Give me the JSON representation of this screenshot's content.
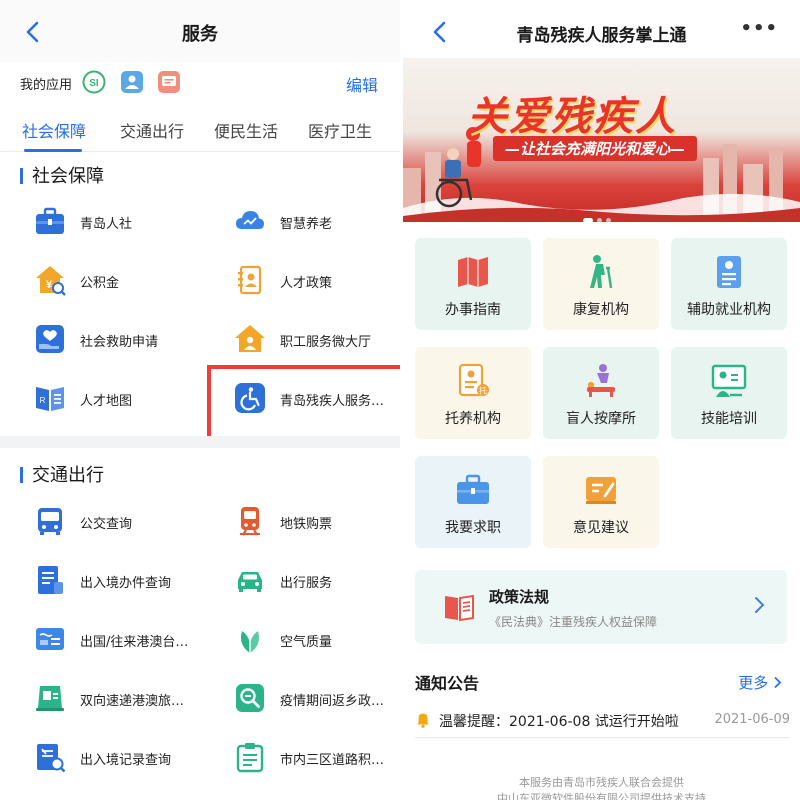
{
  "left": {
    "title": "服务",
    "my_apps_label": "我的应用",
    "my_apps_icons": [
      "si-icon",
      "person-card-icon",
      "chat-icon"
    ],
    "edit_label": "编辑",
    "tabs": [
      {
        "label": "社会保障",
        "active": true
      },
      {
        "label": "交通出行",
        "active": false
      },
      {
        "label": "便民生活",
        "active": false
      },
      {
        "label": "医疗卫生",
        "active": false
      }
    ],
    "sections": [
      {
        "title": "社会保障",
        "items": [
          {
            "label": "青岛人社",
            "icon": "briefcase-icon"
          },
          {
            "label": "智慧养老",
            "icon": "cloud-icon"
          },
          {
            "label": "公积金",
            "icon": "house-fund-icon"
          },
          {
            "label": "人才政策",
            "icon": "talent-doc-icon"
          },
          {
            "label": "社会救助申请",
            "icon": "hand-heart-icon"
          },
          {
            "label": "职工服务微大厅",
            "icon": "worker-hall-icon"
          },
          {
            "label": "人才地图",
            "icon": "book-map-icon"
          },
          {
            "label": "青岛残疾人服务…",
            "icon": "wheelchair-icon"
          }
        ]
      },
      {
        "title": "交通出行",
        "items": [
          {
            "label": "公交查询",
            "icon": "bus-icon"
          },
          {
            "label": "地铁购票",
            "icon": "metro-icon"
          },
          {
            "label": "出入境办件查询",
            "icon": "doc-query-icon"
          },
          {
            "label": "出行服务",
            "icon": "car-icon"
          },
          {
            "label": "出国/往来港澳台…",
            "icon": "passport-icon"
          },
          {
            "label": "空气质量",
            "icon": "leaf-icon"
          },
          {
            "label": "双向速递港澳旅…",
            "icon": "express-icon"
          },
          {
            "label": "疫情期间返乡政…",
            "icon": "search-badge-icon"
          },
          {
            "label": "出入境记录查询",
            "icon": "plane-record-icon"
          },
          {
            "label": "市内三区道路积…",
            "icon": "clipboard-icon"
          }
        ]
      }
    ]
  },
  "right": {
    "title": "青岛残疾人服务掌上通",
    "more_glyph": "•••",
    "banner": {
      "title": "关爱残疾人",
      "subtitle": "—让社会充满阳光和爱心—"
    },
    "cards": [
      {
        "label": "办事指南",
        "icon": "map-guide-icon",
        "tone": "green"
      },
      {
        "label": "康复机构",
        "icon": "elder-cane-icon",
        "tone": "yellow"
      },
      {
        "label": "辅助就业机构",
        "icon": "resume-icon",
        "tone": "green"
      },
      {
        "label": "托养机构",
        "icon": "care-doc-icon",
        "tone": "yellow"
      },
      {
        "label": "盲人按摩所",
        "icon": "massage-icon",
        "tone": "green"
      },
      {
        "label": "技能培训",
        "icon": "training-board-icon",
        "tone": "green"
      },
      {
        "label": "我要求职",
        "icon": "job-bag-icon",
        "tone": "blue"
      },
      {
        "label": "意见建议",
        "icon": "feedback-icon",
        "tone": "yellow"
      }
    ],
    "policy": {
      "title": "政策法规",
      "subtitle": "《民法典》注重残疾人权益保障"
    },
    "notice": {
      "heading": "通知公告",
      "more_label": "更多",
      "items": [
        {
          "text": "温馨提醒：2021-06-08 试运行开始啦",
          "date": "2021-06-09"
        }
      ]
    },
    "footer": {
      "line1": "本服务由青岛市残疾人联合会提供",
      "line2": "中山东亚微软件股份有限公司提供技术支持"
    }
  },
  "colors": {
    "accent": "#2a6ee8",
    "highlight_border": "#ee3b3b"
  }
}
